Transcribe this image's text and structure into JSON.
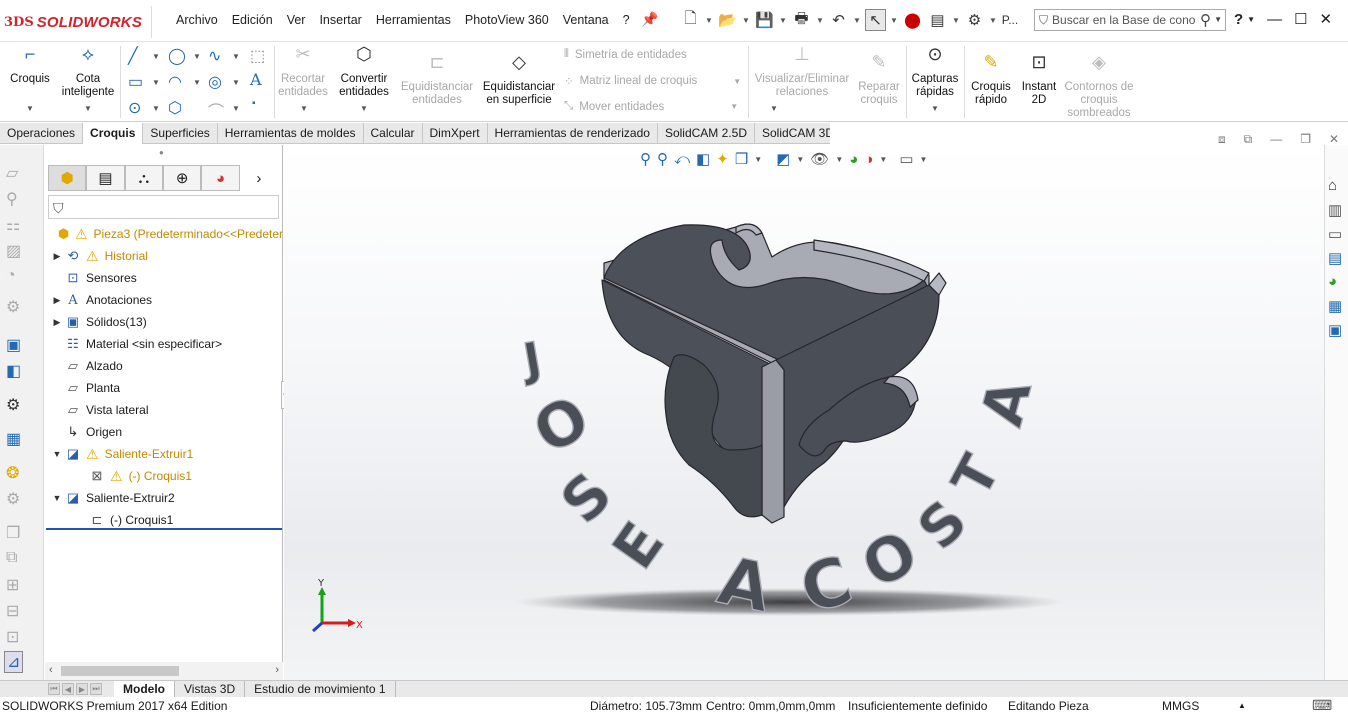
{
  "app": {
    "brand_prefix": "3DS",
    "brand": "SOLIDWORKS"
  },
  "menu": [
    "Archivo",
    "Edición",
    "Ver",
    "Insertar",
    "Herramientas",
    "PhotoView 360",
    "Ventana",
    "?"
  ],
  "quick_access": {
    "truncated_label": "P..."
  },
  "search": {
    "placeholder": "Buscar en la Base de cono"
  },
  "window_controls": {
    "help": "?",
    "minimize": "—",
    "maximize": "☐",
    "close": "✕"
  },
  "ribbon": {
    "croquis": "Croquis",
    "cota": "Cota inteligente",
    "recortar": "Recortar entidades",
    "convertir": "Convertir entidades",
    "equidistanciar": "Equidistanciar entidades",
    "equidistanciar_sup": "Equidistanciar en superficie",
    "simetria": "Simetría de entidades",
    "matriz": "Matriz lineal de croquis",
    "mover": "Mover entidades",
    "visualizar": "Visualizar/Eliminar relaciones",
    "reparar": "Reparar croquis",
    "capturas": "Capturas rápidas",
    "croquis_rapido": "Croquis rápido",
    "instant2d": "Instant 2D",
    "contornos": "Contornos de croquis sombreados"
  },
  "tabs": [
    "Operaciones",
    "Croquis",
    "Superficies",
    "Herramientas de moldes",
    "Calcular",
    "DimXpert",
    "Herramientas de renderizado",
    "SolidCAM 2.5D",
    "SolidCAM 3D"
  ],
  "active_tab": "Croquis",
  "tree": {
    "root": "Pieza3  (Predeterminado<<Predeter",
    "items": [
      "Historial",
      "Sensores",
      "Anotaciones",
      "Sólidos(13)",
      "Material <sin especificar>",
      "Alzado",
      "Planta",
      "Vista lateral",
      "Origen",
      "Saliente-Extruir1",
      "(-) Croquis1",
      "Saliente-Extruir2",
      "(-) Croquis1"
    ]
  },
  "model_text": {
    "line1": "JOSE",
    "line2": "ACOSTA"
  },
  "triad": {
    "x": "X",
    "y": "Y"
  },
  "bottom_tabs": [
    "Modelo",
    "Vistas 3D",
    "Estudio de movimiento 1"
  ],
  "status": {
    "product": "SOLIDWORKS Premium 2017 x64 Edition",
    "diametro": "Diámetro: 105.73mm",
    "centro": "Centro: 0mm,0mm,0mm",
    "definido": "Insuficientemente definido",
    "editando": "Editando Pieza",
    "units": "MMGS"
  },
  "colors": {
    "brand_red": "#d2232a",
    "accent_blue": "#2369b3",
    "model_face": "#4c5059",
    "model_edge": "#a9abb5",
    "warning": "#e0a800"
  }
}
